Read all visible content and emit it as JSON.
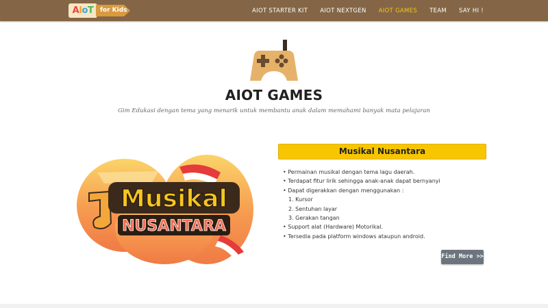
{
  "brand": {
    "logo_main": "AIoT",
    "logo_tag": "for Kids",
    "colors": {
      "nav_bg": "#846646",
      "active": "#f5c518",
      "accent": "#f7c600"
    }
  },
  "nav": {
    "items": [
      {
        "label": "AIOT STARTER KIT",
        "active": false
      },
      {
        "label": "AIOT NEXTGEN",
        "active": false
      },
      {
        "label": "AIOT GAMES",
        "active": true
      },
      {
        "label": "TEAM",
        "active": false
      },
      {
        "label": "SAY HI !",
        "active": false
      }
    ]
  },
  "hero": {
    "icon": "gamepad-icon",
    "title": "AIOT GAMES",
    "subtitle": "Gim Edukasi dengan tema yang menarik untuk membantu anak dalam memahami banyak mata pelajaran"
  },
  "game": {
    "art_line1": "Musikal",
    "art_line2": "NUSANTARA",
    "title": "Musikal Nusantara",
    "features": [
      "• Permainan musikal dengan tema lagu daerah.",
      "• Terdapat fitur lirik sehingga anak-anak dapat bernyanyi",
      "• Dapat digerakkan dengan menggunakan :",
      "1. Kursor",
      "2. Sentuhan layar",
      "3. Gerakan tangan",
      "• Support alat (Hardware) Motorikal.",
      "• Tersedia pada platform windows ataupun android."
    ],
    "button": "Find More >>"
  }
}
